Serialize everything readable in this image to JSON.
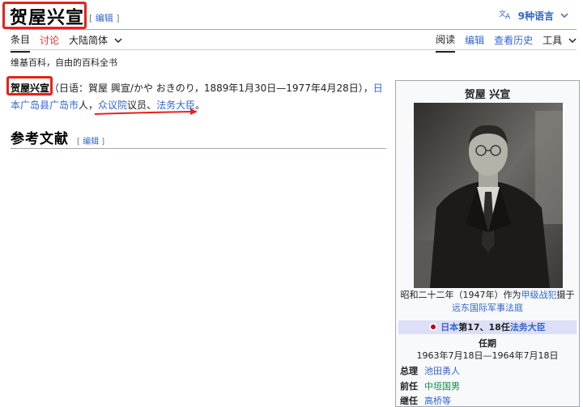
{
  "title": "贺屋兴宣",
  "title_edit": "编辑",
  "languages_label": "9种语言",
  "tabs_left": [
    {
      "label": "条目"
    },
    {
      "label": "讨论"
    },
    {
      "label": "大陆简体"
    }
  ],
  "tabs_right": [
    {
      "label": "阅读"
    },
    {
      "label": "编辑"
    },
    {
      "label": "查看历史"
    },
    {
      "label": "工具"
    }
  ],
  "tagline": "维基百科，自由的百科全书",
  "lead": {
    "name": "贺屋兴宣",
    "paren": "（日语：賀屋 興宣/かや おきのり，1889年1月30日—1977年4月28日），",
    "birthplace_link": "日本广岛县广岛市",
    "mid_text": "人，",
    "link_chamber": "众议院",
    "member_text": "议员、",
    "link_minister": "法务大臣",
    "end": "。"
  },
  "refs": {
    "heading": "参考文献",
    "edit": "编辑"
  },
  "infobox": {
    "title": "贺屋 兴宣",
    "caption_prefix": "昭和二十二年（1947年）作为",
    "caption_link1": "甲级战犯",
    "caption_mid": "摄于",
    "caption_link2": "远东国际军事法庭",
    "office_link1": "日本",
    "office_text": "第17、18任",
    "office_link2": "法务大臣",
    "tenure_label": "任期",
    "tenure": "1963年7月18日—1964年7月18日",
    "rows": [
      {
        "k": "总理",
        "v": "池田勇人"
      },
      {
        "k": "前任",
        "v": "中垣国男"
      },
      {
        "k": "继任",
        "v": "高桥等"
      }
    ]
  },
  "colors": {
    "link": "#3366cc",
    "highlight_box": "#e8211a",
    "office_bar": "#dcdff7"
  }
}
